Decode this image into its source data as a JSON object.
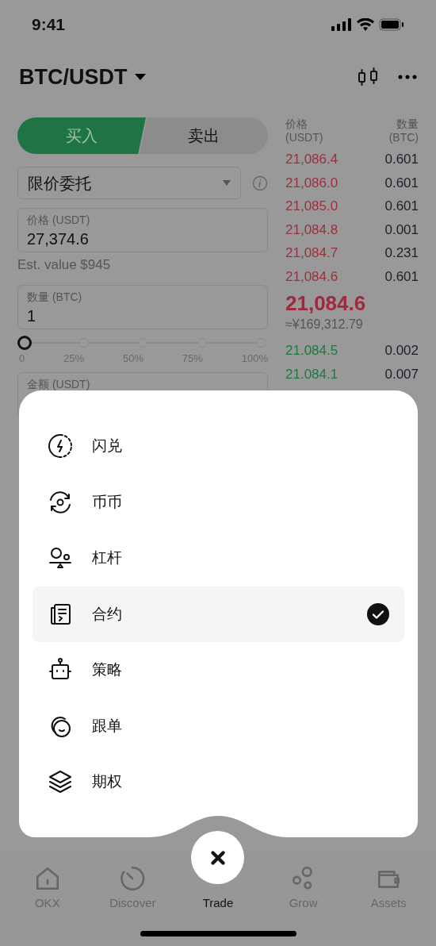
{
  "status_bar": {
    "time": "9:41"
  },
  "header": {
    "pair": "BTC/USDT"
  },
  "order_side_tabs": [
    {
      "label": "买入",
      "selected": true
    },
    {
      "label": "卖出",
      "selected": false
    }
  ],
  "order_type": {
    "value": "限价委托"
  },
  "price_field": {
    "label": "价格 (USDT)",
    "value": "27,374.6"
  },
  "est_value": "Est. value $945",
  "amount_field": {
    "label": "数量 (BTC)",
    "value": "1"
  },
  "slider": {
    "level": 0,
    "ticks": [
      "0",
      "25%",
      "50%",
      "75%",
      "100%"
    ]
  },
  "total_field": {
    "label": "金额 (USDT)"
  },
  "order_book": {
    "columns": [
      {
        "label": "价格",
        "unit": "(USDT)"
      },
      {
        "label": "数量",
        "unit": "(BTC)"
      }
    ],
    "asks": [
      {
        "price": "21,086.4",
        "qty": "0.601"
      },
      {
        "price": "21,086.0",
        "qty": "0.601"
      },
      {
        "price": "21,085.0",
        "qty": "0.601"
      },
      {
        "price": "21,084.8",
        "qty": "0.001"
      },
      {
        "price": "21,084.7",
        "qty": "0.231"
      },
      {
        "price": "21,084.6",
        "qty": "0.601"
      }
    ],
    "last_price": "21,084.6",
    "last_price_cny": "≈¥169,312.79",
    "bids": [
      {
        "price": "21.084.5",
        "qty": "0.002"
      },
      {
        "price": "21.084.1",
        "qty": "0.007"
      }
    ]
  },
  "menu": {
    "items": [
      {
        "label": "闪兑",
        "selected": false
      },
      {
        "label": "币币",
        "selected": false
      },
      {
        "label": "杠杆",
        "selected": false
      },
      {
        "label": "合约",
        "selected": true
      },
      {
        "label": "策略",
        "selected": false
      },
      {
        "label": "跟单",
        "selected": false
      },
      {
        "label": "期权",
        "selected": false
      }
    ]
  },
  "bottom_nav": [
    {
      "label": "OKX",
      "selected": false
    },
    {
      "label": "Discover",
      "selected": false
    },
    {
      "label": "Trade",
      "selected": true
    },
    {
      "label": "Grow",
      "selected": false
    },
    {
      "label": "Assets",
      "selected": false
    }
  ]
}
